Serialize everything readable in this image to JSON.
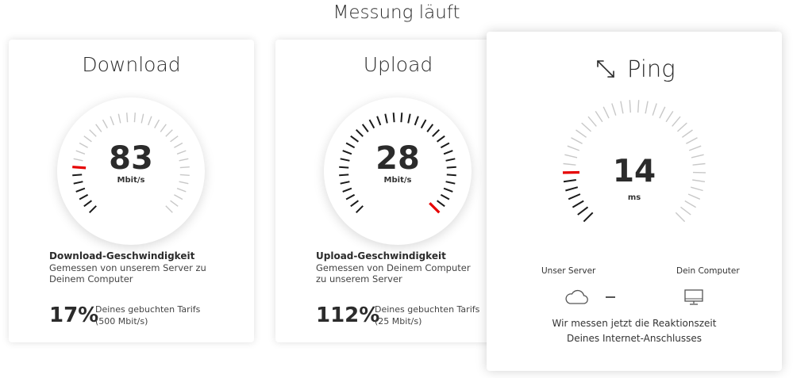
{
  "header": {
    "title": "Messung läuft"
  },
  "download": {
    "title": "Download",
    "value": "83",
    "unit": "Mbit/s",
    "heading": "Download-Geschwindigkeit",
    "description": "Gemessen von unserem Server zu Deinem Computer",
    "percent": "17%",
    "tariff_line1": "Deines gebuchten Tarifs",
    "tariff_line2": "(500 Mbit/s)",
    "gauge_fraction": 0.17
  },
  "upload": {
    "title": "Upload",
    "value": "28",
    "unit": "Mbit/s",
    "heading": "Upload-Geschwindigkeit",
    "description": "Gemessen von Deinem Computer zu unserem Server",
    "percent": "112%",
    "tariff_line1": "Deines gebuchten Tarifs",
    "tariff_line2": "(25 Mbit/s)",
    "gauge_fraction": 1.0
  },
  "ping": {
    "title": "Ping",
    "icon": "expand-arrows-icon",
    "value": "14",
    "unit": "ms",
    "server_label": "Unser Server",
    "computer_label": "Dein Computer",
    "server_icon": "cloud-icon",
    "computer_icon": "monitor-icon",
    "note_line1": "Wir messen jetzt die Reaktionszeit",
    "note_line2": "Deines Internet-Anschlusses",
    "gauge_fraction": 0.17
  },
  "colors": {
    "active_tick": "#1a1a1a",
    "inactive_tick": "#c8c8c8",
    "needle": "#e60000"
  }
}
